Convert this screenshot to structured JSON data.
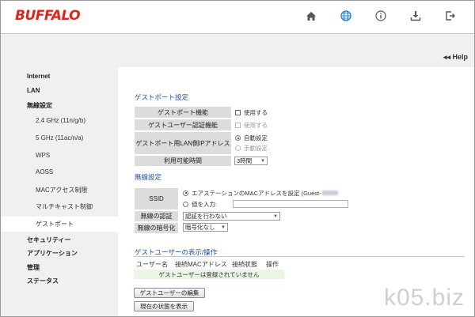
{
  "header": {
    "logo": "BUFFALO",
    "icons": [
      "home-icon",
      "globe-icon",
      "info-icon",
      "download-icon",
      "logout-icon"
    ]
  },
  "help": {
    "label": "Help",
    "icon": "double-chevron-left-icon"
  },
  "sidebar": {
    "items": [
      {
        "label": "Internet",
        "level": 0
      },
      {
        "label": "LAN",
        "level": 0
      },
      {
        "label": "無線設定",
        "level": 0
      },
      {
        "label": "2.4 GHz (11n/g/b)",
        "level": 1
      },
      {
        "label": "5 GHz (11ac/n/a)",
        "level": 1
      },
      {
        "label": "WPS",
        "level": 1
      },
      {
        "label": "AOSS",
        "level": 1
      },
      {
        "label": "MACアクセス制限",
        "level": 1
      },
      {
        "label": "マルチキャスト制御",
        "level": 1
      },
      {
        "label": "ゲストポート",
        "level": 1,
        "active": true
      },
      {
        "label": "セキュリティー",
        "level": 0
      },
      {
        "label": "アプリケーション",
        "level": 0
      },
      {
        "label": "管理",
        "level": 0
      },
      {
        "label": "ステータス",
        "level": 0
      }
    ]
  },
  "guest_port": {
    "title": "ゲストポート設定",
    "function_label": "ゲストポート機能",
    "function_value": "使用する",
    "auth_label": "ゲストユーザー認証機能",
    "auth_value": "使用する",
    "lan_ip_label": "ゲストポート用LAN側IPアドレス",
    "lan_ip_auto": "自動設定",
    "lan_ip_manual": "手動設定",
    "time_label": "利用可能時間",
    "time_value": "3時間"
  },
  "wireless": {
    "title": "無線設定",
    "ssid_label": "SSID",
    "ssid_option1": "エアステーションのMACアドレスを設定 (Guest-",
    "ssid_option2": "値を入力:",
    "auth_label": "無線の認証",
    "auth_value": "認証を行わない",
    "enc_label": "無線の暗号化",
    "enc_value": "暗号化なし"
  },
  "guest_users": {
    "title": "ゲストユーザーの表示/操作",
    "columns": [
      "ユーザー名",
      "接続MACアドレス",
      "接続状態",
      "操作"
    ],
    "empty_message": "ゲストユーザーは登録されていません",
    "edit_button": "ゲストユーザーの編集",
    "refresh_button": "現在の状態を表示"
  },
  "watermark": "k05.biz",
  "colors": {
    "logo": "#e2231a",
    "section_title": "#1f4fa0",
    "active_icon": "#1e7fd6",
    "empty_row_bg": "#e8f6e3"
  }
}
